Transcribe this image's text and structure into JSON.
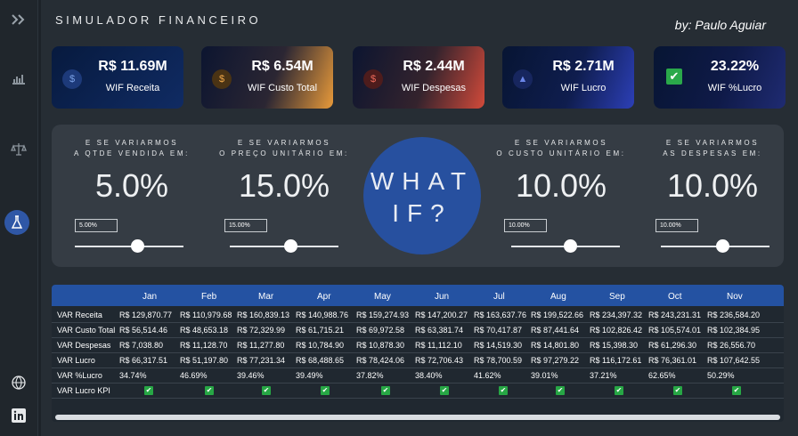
{
  "sidebar": {
    "icons": [
      "chevron-double-right-icon",
      "bar-chart-icon",
      "scale-icon",
      "flask-icon",
      "globe-icon",
      "linkedin-icon"
    ]
  },
  "header": {
    "title": "SIMULADOR FINANCEIRO",
    "author": "by: Paulo Aguiar"
  },
  "kpis": [
    {
      "value": "R$ 11.69M",
      "label": "WIF Receita",
      "icon": "money-bag-icon",
      "color": "#1a2c5a"
    },
    {
      "value": "R$ 6.54M",
      "label": "WIF Custo Total",
      "icon": "coin-icon",
      "color": "#e08a2a"
    },
    {
      "value": "R$ 2.44M",
      "label": "WIF Despesas",
      "icon": "hand-coin-icon",
      "color": "#d0483a"
    },
    {
      "value": "R$ 2.71M",
      "label": "WIF Lucro",
      "icon": "growth-chart-icon",
      "color": "#2c3fb0"
    },
    {
      "value": "23.22%",
      "label": "WIF %Lucro",
      "icon": "check-icon",
      "color": "#1f2b70"
    }
  ],
  "sliders": [
    {
      "question": "E SE VARIARMOS\nA QTDE VENDIDA EM:",
      "value_text": "5.0%",
      "box": "5.00%",
      "level": 0.55
    },
    {
      "question": "E SE VARIARMOS\nO PREÇO UNITÁRIO EM:",
      "value_text": "15.0%",
      "box": "15.00%",
      "level": 0.55
    },
    {
      "question": "E SE VARIARMOS\nO CUSTO UNITÁRIO EM:",
      "value_text": "10.0%",
      "box": "10.00%",
      "level": 0.55
    },
    {
      "question": "E SE VARIARMOS\nAS DESPESAS EM:",
      "value_text": "10.0%",
      "box": "10.00%",
      "level": 0.55
    }
  ],
  "whatif": {
    "line1": "WHAT",
    "line2": "IF?"
  },
  "table": {
    "months": [
      "Jan",
      "Feb",
      "Mar",
      "Apr",
      "May",
      "Jun",
      "Jul",
      "Aug",
      "Sep",
      "Oct",
      "Nov"
    ],
    "rows": [
      {
        "label": "VAR Receita",
        "values": [
          "R$ 129,870.77",
          "R$ 110,979.68",
          "R$ 160,839.13",
          "R$ 140,988.76",
          "R$ 159,274.93",
          "R$ 147,200.27",
          "R$ 163,637.76",
          "R$ 199,522.66",
          "R$ 234,397.32",
          "R$ 243,231.31",
          "R$ 236,584.20"
        ]
      },
      {
        "label": "VAR Custo Total",
        "values": [
          "R$ 56,514.46",
          "R$ 48,653.18",
          "R$ 72,329.99",
          "R$ 61,715.21",
          "R$ 69,972.58",
          "R$ 63,381.74",
          "R$ 70,417.87",
          "R$ 87,441.64",
          "R$ 102,826.42",
          "R$ 105,574.01",
          "R$ 102,384.95"
        ]
      },
      {
        "label": "VAR Despesas",
        "values": [
          "R$ 7,038.80",
          "R$ 11,128.70",
          "R$ 11,277.80",
          "R$ 10,784.90",
          "R$ 10,878.30",
          "R$ 11,112.10",
          "R$ 14,519.30",
          "R$ 14,801.80",
          "R$ 15,398.30",
          "R$ 61,296.30",
          "R$ 26,556.70"
        ]
      },
      {
        "label": "VAR Lucro",
        "values": [
          "R$ 66,317.51",
          "R$ 51,197.80",
          "R$ 77,231.34",
          "R$ 68,488.65",
          "R$ 78,424.06",
          "R$ 72,706.43",
          "R$ 78,700.59",
          "R$ 97,279.22",
          "R$ 116,172.61",
          "R$ 76,361.01",
          "R$ 107,642.55"
        ]
      },
      {
        "label": "VAR %Lucro",
        "values": [
          "34.74%",
          "46.69%",
          "39.46%",
          "39.49%",
          "37.82%",
          "38.40%",
          "41.62%",
          "39.01%",
          "37.21%",
          "62.65%",
          "50.29%"
        ]
      },
      {
        "label": "VAR Lucro KPI",
        "values": [
          "✔",
          "✔",
          "✔",
          "✔",
          "✔",
          "✔",
          "✔",
          "✔",
          "✔",
          "✔",
          "✔"
        ]
      }
    ]
  }
}
